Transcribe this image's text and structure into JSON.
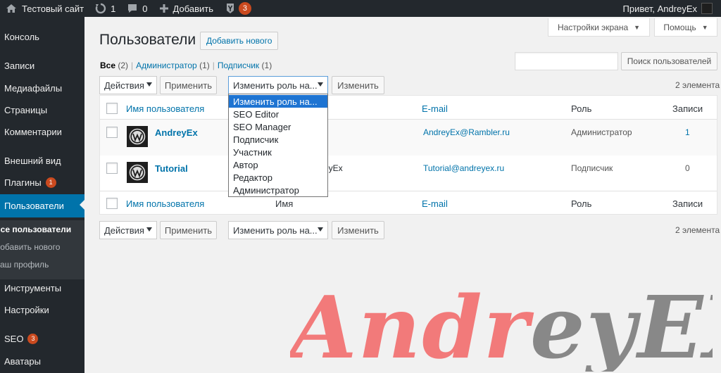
{
  "adminbar": {
    "site_name": "Тестовый сайт",
    "updates_count": "1",
    "comments_count": "0",
    "add_label": "Добавить",
    "yoast_badge": "3",
    "greeting": "Привет, AndreyEx"
  },
  "sidebar": {
    "items": [
      {
        "label": "Консоль"
      },
      {
        "label": "Записи"
      },
      {
        "label": "Медиафайлы"
      },
      {
        "label": "Страницы"
      },
      {
        "label": "Комментарии"
      },
      {
        "label": "Внешний вид"
      },
      {
        "label": "Плагины",
        "badge": "1"
      },
      {
        "label": "Пользователи"
      },
      {
        "label": "Инструменты"
      },
      {
        "label": "Настройки"
      },
      {
        "label": "SEO",
        "badge": "3"
      },
      {
        "label": "Аватары"
      }
    ],
    "submenu": [
      {
        "label": "Все пользователи"
      },
      {
        "label": "Добавить нового"
      },
      {
        "label": "Ваш профиль"
      }
    ]
  },
  "screen_meta": {
    "screen_options": "Настройки экрана",
    "help": "Помощь"
  },
  "page": {
    "title": "Пользователи",
    "add_new": "Добавить нового"
  },
  "filters": {
    "all": {
      "label": "Все",
      "count": "(2)"
    },
    "administrator": {
      "label": "Администратор",
      "count": "(1)"
    },
    "subscriber": {
      "label": "Подписчик",
      "count": "(1)"
    }
  },
  "search": {
    "value": "",
    "button": "Поиск пользователей"
  },
  "tablenav_top": {
    "bulk_select": "Действия",
    "apply": "Применить",
    "role_select": "Изменить роль на...",
    "change": "Изменить",
    "count": "2 элемента"
  },
  "tablenav_bottom": {
    "bulk_select": "Действия",
    "apply": "Применить",
    "role_select": "Изменить роль на...",
    "change": "Изменить",
    "count": "2 элемента"
  },
  "table": {
    "columns": {
      "username": "Имя пользователя",
      "name": "Имя",
      "email": "E-mail",
      "role": "Роль",
      "posts": "Записи"
    },
    "rows": [
      {
        "username": "AndreyEx",
        "name": "",
        "email": "AndreyEx@Rambler.ru",
        "role": "Администратор",
        "posts": "1"
      },
      {
        "username": "Tutorial",
        "name": "eyEx",
        "email": "Tutorial@andreyex.ru",
        "role": "Подписчик",
        "posts": "0"
      }
    ]
  },
  "role_dropdown": {
    "options": [
      "Изменить роль на...",
      "SEO Editor",
      "SEO Manager",
      "Подписчик",
      "Участник",
      "Автор",
      "Редактор",
      "Администратор"
    ]
  },
  "watermark": {
    "part1": "Andr",
    "part2": "ey",
    "part3": "EX",
    "color1": "#f27a7a",
    "color2": "#888888"
  }
}
